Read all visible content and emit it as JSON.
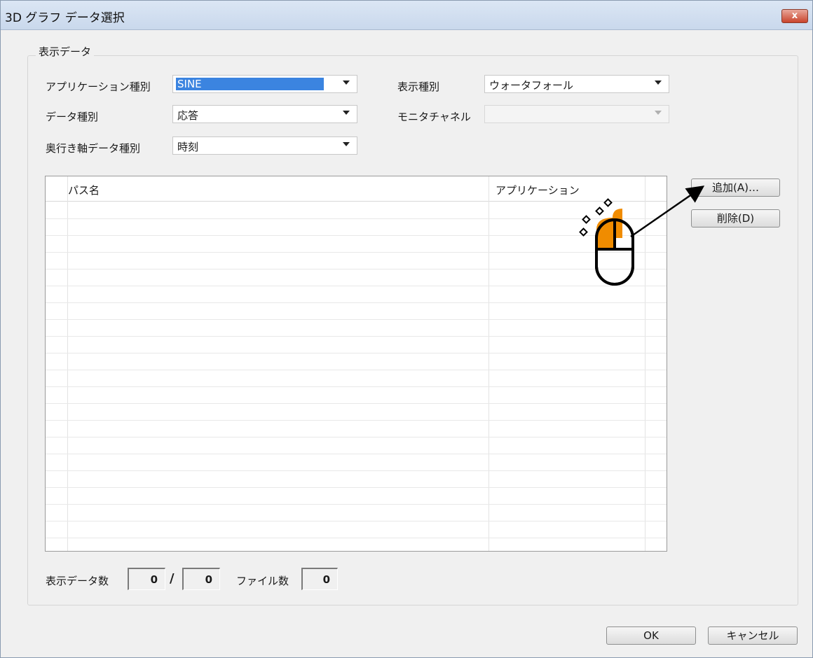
{
  "window": {
    "title": "3D グラフ データ選択",
    "close_label": "x"
  },
  "group": {
    "label": "表示データ"
  },
  "fields": {
    "app_type": {
      "label": "アプリケーション種別",
      "value": "SINE"
    },
    "data_type": {
      "label": "データ種別",
      "value": "応答"
    },
    "depth_axis": {
      "label": "奥行き軸データ種別",
      "value": "時刻"
    },
    "display_type": {
      "label": "表示種別",
      "value": "ウォータフォール"
    },
    "monitor_channel": {
      "label": "モニタチャネル",
      "value": ""
    }
  },
  "grid": {
    "columns": [
      "パス名",
      "アプリケーション"
    ],
    "rows": []
  },
  "buttons": {
    "add": "追加(A)…",
    "delete": "削除(D)",
    "ok": "OK",
    "cancel": "キャンセル"
  },
  "counts": {
    "display_label": "表示データ数",
    "display_value": "0",
    "slash": "/",
    "display_total": "0",
    "file_label": "ファイル数",
    "file_value": "0"
  },
  "annotation": {
    "mouse_left_button_color": "#f08c00",
    "icon": "mouse-click-icon"
  }
}
